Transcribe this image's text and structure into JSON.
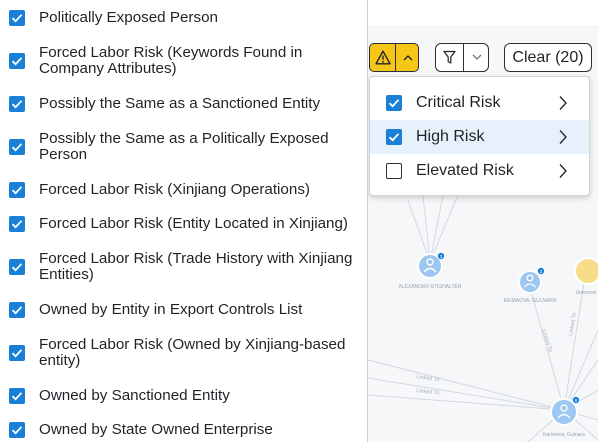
{
  "list": {
    "items": [
      {
        "label": "Politically Exposed Person",
        "checked": true
      },
      {
        "label": "Forced Labor Risk (Keywords Found in Company Attributes)",
        "checked": true
      },
      {
        "label": "Possibly the Same as a Sanctioned Entity",
        "checked": true
      },
      {
        "label": "Possibly the Same as a Politically Exposed Person",
        "checked": true
      },
      {
        "label": "Forced Labor Risk (Xinjiang Operations)",
        "checked": true
      },
      {
        "label": "Forced Labor Risk (Entity Located in Xinjiang)",
        "checked": true
      },
      {
        "label": "Forced Labor Risk (Trade History with Xinjiang Entities)",
        "checked": true
      },
      {
        "label": "Owned by Entity in Export Controls List",
        "checked": true
      },
      {
        "label": "Forced Labor Risk (Owned by Xinjiang-based entity)",
        "checked": true
      },
      {
        "label": "Owned by Sanctioned Entity",
        "checked": true
      },
      {
        "label": "Owned by State Owned Enterprise",
        "checked": true
      }
    ]
  },
  "toolbar": {
    "risk_icon": "warning-triangle-icon",
    "risk_toggle_icon": "chevron-up-icon",
    "filter_icon": "funnel-icon",
    "filter_toggle_icon": "chevron-down-icon",
    "clear_label": "Clear (20)"
  },
  "dropdown": {
    "items": [
      {
        "label": "Critical Risk",
        "checked": true,
        "selected": false
      },
      {
        "label": "High Risk",
        "checked": true,
        "selected": true
      },
      {
        "label": "Elevated Risk",
        "checked": false,
        "selected": false
      }
    ]
  },
  "graph": {
    "nodes": [
      {
        "label": "ALEXANDER-STIGHALTER",
        "badge": "3"
      },
      {
        "label": "KEIMAOVA, GULNARA",
        "badge": "2"
      },
      {
        "label": "Unknown",
        "badge": ""
      },
      {
        "label": "Karimova, Gulnara",
        "badge": "6"
      }
    ],
    "edge_labels": [
      "Linked To",
      "Linked To",
      "Linked To",
      "Linked To"
    ]
  },
  "colors": {
    "accent": "#1a7fd6",
    "warning": "#f5c518",
    "selected_row": "#e7f1fb",
    "node": "#9cc7f0",
    "node_yellow": "#f7dc8a"
  }
}
